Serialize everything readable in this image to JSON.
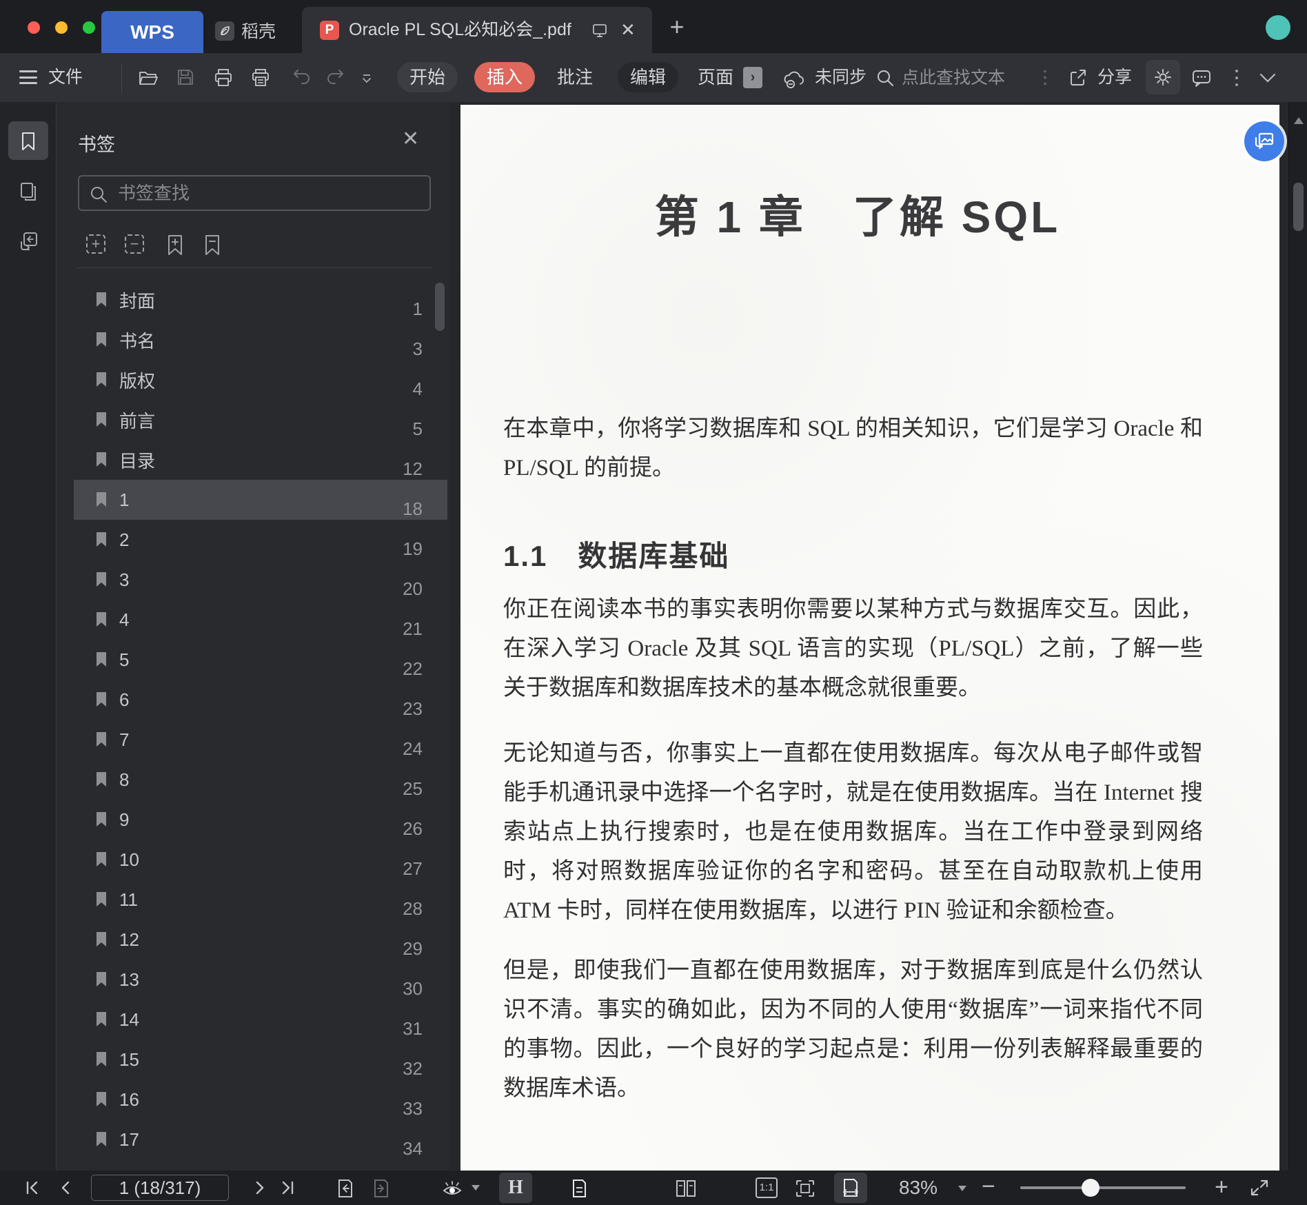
{
  "window": {
    "traffic_lights": [
      "close",
      "minimize",
      "zoom"
    ],
    "wps_home_label": "WPS",
    "docer_label": "稻壳",
    "active_tab_title": "Oracle PL SQL必知必会_.pdf",
    "new_tab_label": "+",
    "close_tab_label": "✕"
  },
  "toolbar": {
    "file_menu": "文件",
    "mode_tabs": [
      {
        "label": "开始"
      },
      {
        "label": "插入",
        "active": true
      },
      {
        "label": "批注"
      },
      {
        "label": "编辑"
      },
      {
        "label": "页面"
      }
    ],
    "page_expand_label": "›",
    "sync_label": "未同步",
    "search_placeholder": "点此查找文本",
    "share_label": "分享"
  },
  "sidebar": {
    "panel_title": "书签",
    "close_label": "✕",
    "search_placeholder": "书签查找",
    "bookmarks": [
      {
        "label": "封面",
        "page": "1"
      },
      {
        "label": "书名",
        "page": "3"
      },
      {
        "label": "版权",
        "page": "4"
      },
      {
        "label": "前言",
        "page": "5"
      },
      {
        "label": "目录",
        "page": "12"
      },
      {
        "label": "1",
        "page": "18",
        "selected": true
      },
      {
        "label": "2",
        "page": "19"
      },
      {
        "label": "3",
        "page": "20"
      },
      {
        "label": "4",
        "page": "21"
      },
      {
        "label": "5",
        "page": "22"
      },
      {
        "label": "6",
        "page": "23"
      },
      {
        "label": "7",
        "page": "24"
      },
      {
        "label": "8",
        "page": "25"
      },
      {
        "label": "9",
        "page": "26"
      },
      {
        "label": "10",
        "page": "27"
      },
      {
        "label": "11",
        "page": "28"
      },
      {
        "label": "12",
        "page": "29"
      },
      {
        "label": "13",
        "page": "30"
      },
      {
        "label": "14",
        "page": "31"
      },
      {
        "label": "15",
        "page": "32"
      },
      {
        "label": "16",
        "page": "33"
      },
      {
        "label": "17",
        "page": "34"
      }
    ]
  },
  "document": {
    "chapter_title": "第 1 章　了解 SQL",
    "intro_paragraph": "在本章中，你将学习数据库和 SQL 的相关知识，它们是学习 Oracle 和 PL/SQL 的前提。",
    "section_heading": "1.1　数据库基础",
    "paragraphs": [
      "你正在阅读本书的事实表明你需要以某种方式与数据库交互。因此，在深入学习 Oracle 及其 SQL 语言的实现（PL/SQL）之前，了解一些关于数据库和数据库技术的基本概念就很重要。",
      "无论知道与否，你事实上一直都在使用数据库。每次从电子邮件或智能手机通讯录中选择一个名字时，就是在使用数据库。当在 Internet 搜索站点上执行搜索时，也是在使用数据库。当在工作中登录到网络时，将对照数据库验证你的名字和密码。甚至在自动取款机上使用 ATM 卡时，同样在使用数据库，以进行 PIN 验证和余额检查。",
      "但是，即使我们一直都在使用数据库，对于数据库到底是什么仍然认识不清。事实的确如此，因为不同的人使用“数据库”一词来指代不同的事物。因此，一个良好的学习起点是：利用一份列表解释最重要的数据库术语。"
    ]
  },
  "statusbar": {
    "page_indicator": "1 (18/317)",
    "zoom_level": "83%",
    "hand_tool_label": "H",
    "one_to_one_label": "1:1"
  },
  "colors": {
    "brand_blue": "#3b66c4",
    "insert_accent_red": "#e0675c",
    "pdf_icon_red": "#e8564e",
    "avatar_teal": "#4fc3b8",
    "float_button_blue": "#3f7ee8"
  }
}
